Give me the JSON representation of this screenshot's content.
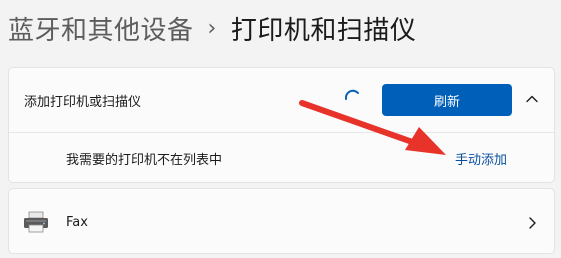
{
  "breadcrumb": {
    "parent": "蓝牙和其他设备",
    "separator": "›",
    "current": "打印机和扫描仪"
  },
  "add_printer": {
    "title": "添加打印机或扫描仪",
    "refresh_label": "刷新",
    "missing_text": "我需要的打印机不在列表中",
    "manual_link": "手动添加"
  },
  "devices": [
    {
      "name": "Fax",
      "icon": "printer-icon"
    }
  ],
  "colors": {
    "accent": "#005fb8",
    "link": "#0a4f9e",
    "arrow": "#e8332a"
  },
  "icons": {
    "spinner": "loading-spinner-icon",
    "collapse": "chevron-up-icon",
    "expand": "chevron-right-icon",
    "annotation": "red-arrow"
  }
}
